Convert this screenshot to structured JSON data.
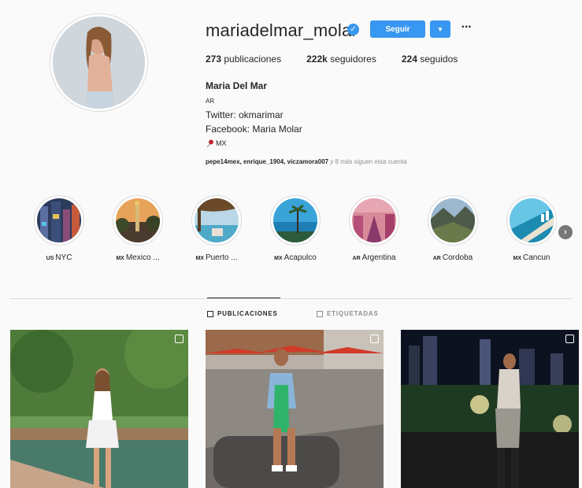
{
  "profile": {
    "username": "mariadelmar_molar",
    "follow_label": "Seguir",
    "dropdown_icon": "chevron-down-icon",
    "more_icon": "···",
    "stats": [
      {
        "count": "273",
        "label": "publicaciones"
      },
      {
        "count": "222k",
        "label": "seguidores"
      },
      {
        "count": "224",
        "label": "seguidos"
      }
    ],
    "full_name": "Maria Del Mar",
    "category": "AR",
    "twitter": "Twitter: okmarimar",
    "facebook": "Facebook: Maria Molar",
    "location": "MX",
    "followed_by_names": "pepe14mex, enrique_1904, viczamora007",
    "followed_by_rest": " y 8 más siguen esta cuenta"
  },
  "highlights": [
    {
      "cc": "US",
      "name": "NYC"
    },
    {
      "cc": "MX",
      "name": "Mexico ..."
    },
    {
      "cc": "MX",
      "name": "Puerto ..."
    },
    {
      "cc": "MX",
      "name": "Acapulco"
    },
    {
      "cc": "AR",
      "name": "Argentina"
    },
    {
      "cc": "AR",
      "name": "Cordoba"
    },
    {
      "cc": "MX",
      "name": "Cancun"
    }
  ],
  "tabs": {
    "posts": "PUBLICACIONES",
    "tagged": "ETIQUETADAS"
  },
  "colors": {
    "accent": "#3897f0",
    "text": "#262626",
    "muted": "#8e8e8e",
    "border": "#dbdbdb"
  }
}
